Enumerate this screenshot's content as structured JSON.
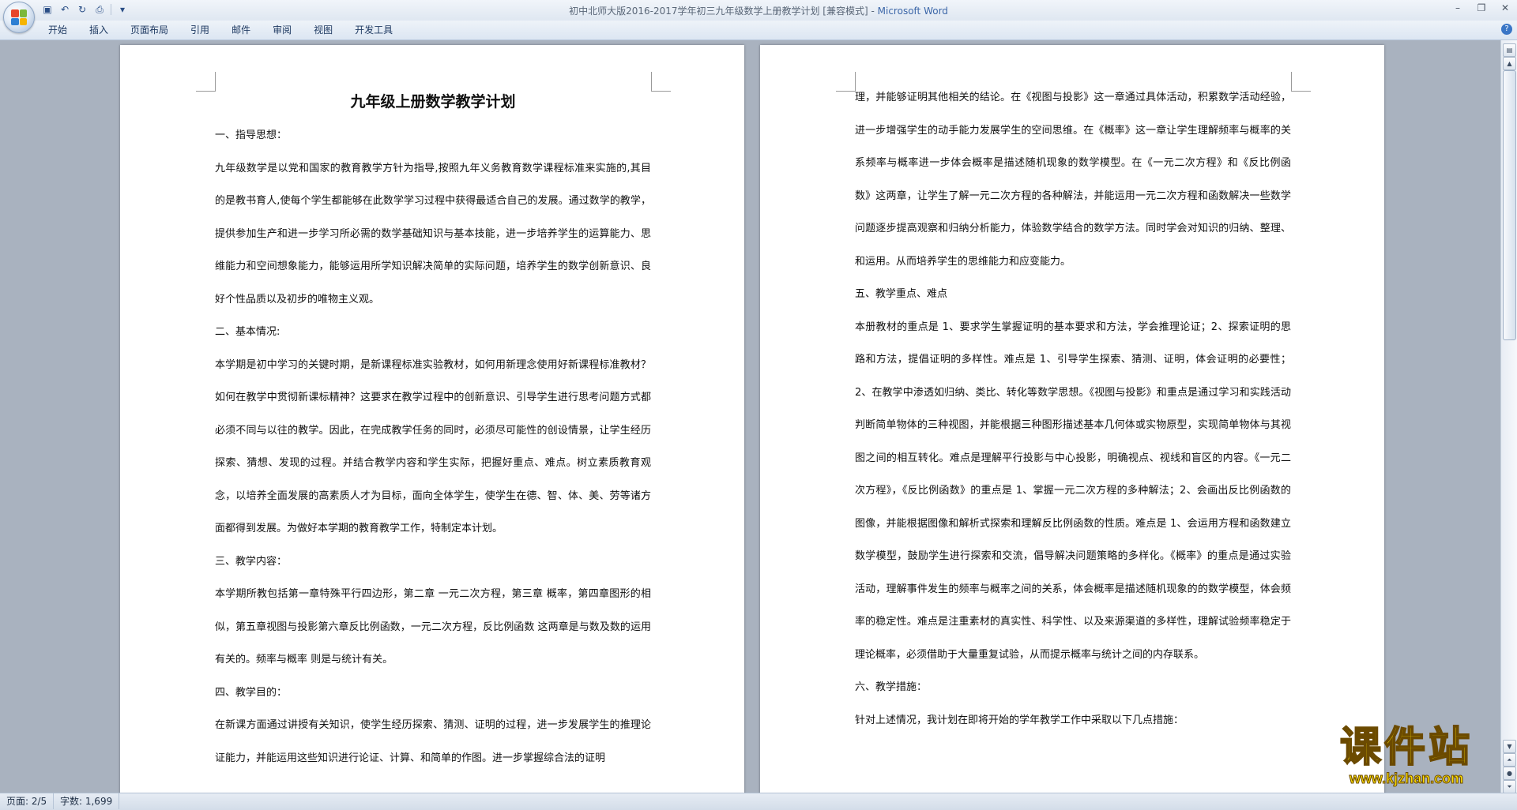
{
  "window": {
    "title": "初中北师大版2016-2017学年初三九年级数学上册教学计划 [兼容模式] - ",
    "app_name": "Microsoft Word",
    "controls": [
      "–",
      "❐",
      "✕"
    ]
  },
  "qat": {
    "icons": [
      "save-icon",
      "undo-icon",
      "redo-icon",
      "print-preview-icon",
      "customize-qat-icon"
    ]
  },
  "ribbon": {
    "tabs": [
      "开始",
      "插入",
      "页面布局",
      "引用",
      "邮件",
      "审阅",
      "视图",
      "开发工具"
    ],
    "help": "?"
  },
  "document": {
    "page_left": {
      "title": "九年级上册数学教学计划",
      "sections": [
        {
          "kind": "heading",
          "text": "一、指导思想："
        },
        {
          "kind": "para",
          "text": "九年级数学是以党和国家的教育教学方针为指导,按照九年义务教育数学课程标准来实施的,其目的是教书育人,使每个学生都能够在此数学学习过程中获得最适合自己的发展。通过数学的教学，提供参加生产和进一步学习所必需的数学基础知识与基本技能，进一步培养学生的运算能力、思维能力和空间想象能力，能够运用所学知识解决简单的实际问题，培养学生的数学创新意识、良好个性品质以及初步的唯物主义观。"
        },
        {
          "kind": "heading",
          "text": "二、基本情况:"
        },
        {
          "kind": "para",
          "text": "本学期是初中学习的关键时期，是新课程标准实验教材，如何用新理念使用好新课程标准教材？如何在教学中贯彻新课标精神？这要求在教学过程中的创新意识、引导学生进行思考问题方式都必须不同与以往的教学。因此，在完成教学任务的同时，必须尽可能性的创设情景，让学生经历探索、猜想、发现的过程。并结合教学内容和学生实际，把握好重点、难点。树立素质教育观念，以培养全面发展的高素质人才为目标，面向全体学生，使学生在德、智、体、美、劳等诸方面都得到发展。为做好本学期的教育教学工作，特制定本计划。"
        },
        {
          "kind": "heading",
          "text": " 三、教学内容："
        },
        {
          "kind": "para",
          "text": "本学期所教包括第一章特殊平行四边形，第二章 一元二次方程，第三章 概率，第四章图形的相似，第五章视图与投影第六章反比例函数，一元二次方程，反比例函数 这两章是与数及数的运用有关的。频率与概率 则是与统计有关。"
        },
        {
          "kind": "heading",
          "text": "四、教学目的："
        },
        {
          "kind": "para",
          "text": "在新课方面通过讲授有关知识，使学生经历探索、猜测、证明的过程，进一步发展学生的推理论证能力，并能运用这些知识进行论证、计算、和简单的作图。进一步掌握综合法的证明"
        }
      ]
    },
    "page_right": {
      "sections": [
        {
          "kind": "para",
          "text": "理，并能够证明其他相关的结论。在《视图与投影》这一章通过具体活动，积累数学活动经验，进一步增强学生的动手能力发展学生的空间思维。在《概率》这一章让学生理解频率与概率的关系频率与概率进一步体会概率是描述随机现象的数学模型。在《一元二次方程》和《反比例函数》这两章，让学生了解一元二次方程的各种解法，并能运用一元二次方程和函数解决一些数学问题逐步提高观察和归纳分析能力，体验数学结合的数学方法。同时学会对知识的归纳、整理、和运用。从而培养学生的思维能力和应变能力。"
        },
        {
          "kind": "heading",
          "text": "五、教学重点、难点"
        },
        {
          "kind": "para",
          "text": "本册教材的重点是 1、要求学生掌握证明的基本要求和方法，学会推理论证；2、探索证明的思路和方法，提倡证明的多样性。难点是 1、引导学生探索、猜测、证明，体会证明的必要性；2、在教学中渗透如归纳、类比、转化等数学思想。《视图与投影》和重点是通过学习和实践活动判断简单物体的三种视图，并能根据三种图形描述基本几何体或实物原型，实现简单物体与其视图之间的相互转化。难点是理解平行投影与中心投影，明确视点、视线和盲区的内容。《一元二次方程》，《反比例函数》的重点是 1、掌握一元二次方程的多种解法；2、会画出反比例函数的图像，并能根据图像和解析式探索和理解反比例函数的性质。难点是 1、会运用方程和函数建立数学模型，鼓励学生进行探索和交流，倡导解决问题策略的多样化。《概率》的重点是通过实验活动，理解事件发生的频率与概率之间的关系，体会概率是描述随机现象的的数学模型，体会频率的稳定性。难点是注重素材的真实性、科学性、以及来源渠道的多样性，理解试验频率稳定于理论概率，必须借助于大量重复试验，从而提示概率与统计之间的内存联系。"
        },
        {
          "kind": "heading",
          "text": "六、教学措施："
        },
        {
          "kind": "para",
          "text": "针对上述情况，我计划在即将开始的学年教学工作中采取以下几点措施："
        }
      ]
    }
  },
  "statusbar": {
    "page": "页面: 2/5",
    "words": "字数: 1,699"
  },
  "watermark": {
    "main": "课件站",
    "url": "www.kjzhan.com"
  },
  "colors": {
    "workspace": "#a9b2bf",
    "title_app": "#3b66a8",
    "watermark": "#ffe100"
  }
}
